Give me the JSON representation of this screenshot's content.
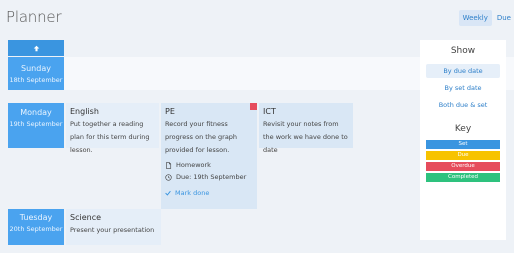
{
  "app": {
    "title": "Planner"
  },
  "view_tabs": [
    "Weekly",
    "Due"
  ],
  "days": [
    {
      "name": "Sunday",
      "date": "18th September"
    },
    {
      "name": "Monday",
      "date": "19th September"
    },
    {
      "name": "Tuesday",
      "date": "20th September"
    }
  ],
  "cards": {
    "english": {
      "subject": "English",
      "desc": "Put together a reading plan for this term during lesson."
    },
    "pe": {
      "subject": "PE",
      "desc": "Record your fitness progress on the graph provided for lesson.",
      "type": "Homework",
      "due": "Due: 19th September",
      "mark_done": "Mark done",
      "status_color": "#e64c5c"
    },
    "ict": {
      "subject": "ICT",
      "desc": "Revisit your notes from the work we have done to date"
    },
    "science": {
      "subject": "Science",
      "desc": "Present your presentation"
    }
  },
  "panel": {
    "show_heading": "Show",
    "filters": [
      "By due date",
      "By set date",
      "Both due & set"
    ],
    "key_heading": "Key",
    "keys": [
      {
        "label": "Set",
        "color": "#3a95e0"
      },
      {
        "label": "Due",
        "color": "#f7c300"
      },
      {
        "label": "Overdue",
        "color": "#e64c5c"
      },
      {
        "label": "Completed",
        "color": "#2ec27e"
      }
    ]
  },
  "icons": [
    "arrow-up-icon",
    "document-icon",
    "clock-icon",
    "check-icon"
  ],
  "colors": {
    "accent": "#3a95e0",
    "day_bg": "#4aa3ef",
    "card_bg": "#d9e7f5"
  }
}
